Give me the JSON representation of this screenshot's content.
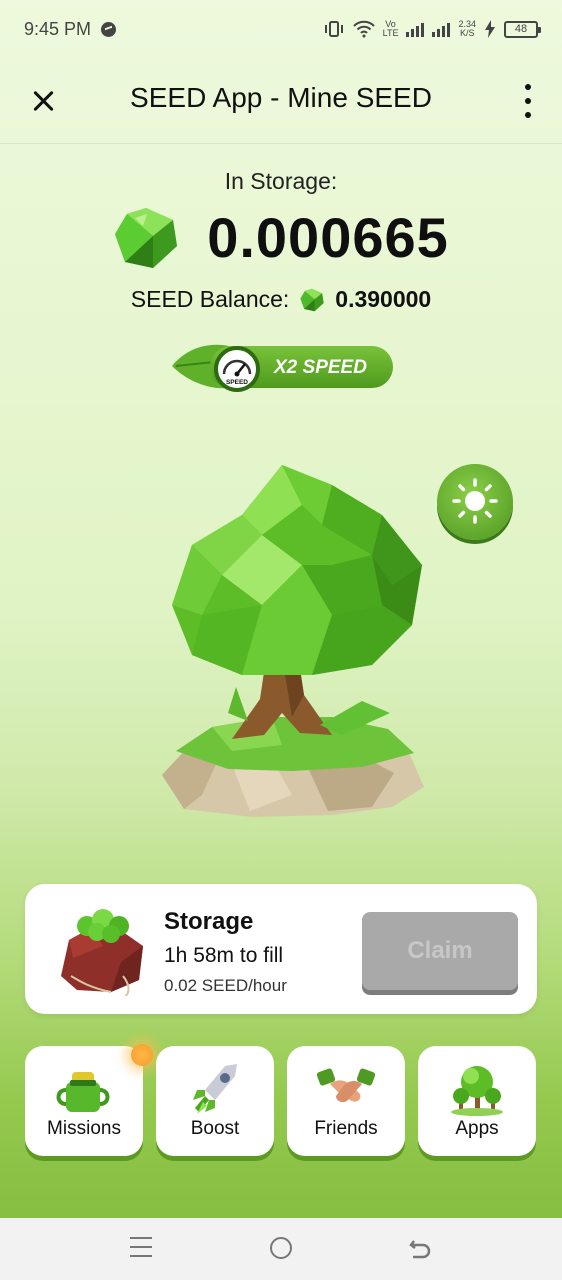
{
  "status_bar": {
    "time": "9:45 PM",
    "net_speed_top": "2.34",
    "net_speed_bottom": "K/S",
    "network_label_top": "Vo",
    "network_label_bottom": "LTE",
    "battery": "48"
  },
  "header": {
    "title": "SEED App - Mine SEED",
    "close_icon": "close-icon",
    "menu_icon": "more-vertical-icon"
  },
  "storage": {
    "label": "In Storage:",
    "amount": "0.000665",
    "balance_label": "SEED Balance:",
    "balance_value": "0.390000"
  },
  "speed_badge": {
    "label": "X2 SPEED",
    "gauge_text": "SPEED"
  },
  "storage_card": {
    "title": "Storage",
    "fill_hours": "1h",
    "fill_minutes": "58m",
    "fill_suffix": "to fill",
    "rate": "0.02 SEED/hour",
    "claim_label": "Claim"
  },
  "tiles": [
    {
      "label": "Missions",
      "icon": "missions-icon"
    },
    {
      "label": "Boost",
      "icon": "rocket-icon"
    },
    {
      "label": "Friends",
      "icon": "handshake-icon"
    },
    {
      "label": "Apps",
      "icon": "trees-icon"
    }
  ],
  "colors": {
    "accent_green": "#5fae2a",
    "claim_disabled": "#a9a9a9",
    "notification_dot": "#f59d2a"
  }
}
